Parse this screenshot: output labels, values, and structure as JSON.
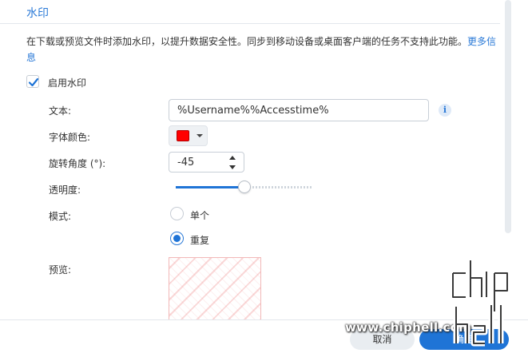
{
  "section": {
    "title": "水印"
  },
  "description": {
    "text": "在下载或预览文件时添加水印，以提升数据安全性。同步到移动设备或桌面客户端的任务不支持此功能。",
    "link_line1": "更",
    "link_line2": "多信息"
  },
  "enable": {
    "label": "启用水印",
    "checked": true
  },
  "fields": {
    "text_label": "文本:",
    "text_value": "%Username%%Accesstime%",
    "font_color_label": "字体颜色:",
    "font_color": "#ff0000",
    "rotation_label": "旋转角度 (°):",
    "rotation_value": "-45",
    "opacity_label": "透明度:",
    "opacity_level": 0.5,
    "mode_label": "模式:",
    "mode_options": [
      "单个",
      "重复"
    ],
    "mode_selected": "重复",
    "preview_label": "预览:"
  },
  "info_icon": "i",
  "buttons": {
    "cancel": "取消",
    "ok": "确定"
  },
  "overlay": {
    "site_watermark": "www.chiphell.com",
    "logo_text": "chip hell",
    "logo_icon": "chiphell-logo"
  },
  "colors": {
    "accent": "#1f74d6",
    "title": "#2b7ad7",
    "swatch": "#ff0000"
  }
}
